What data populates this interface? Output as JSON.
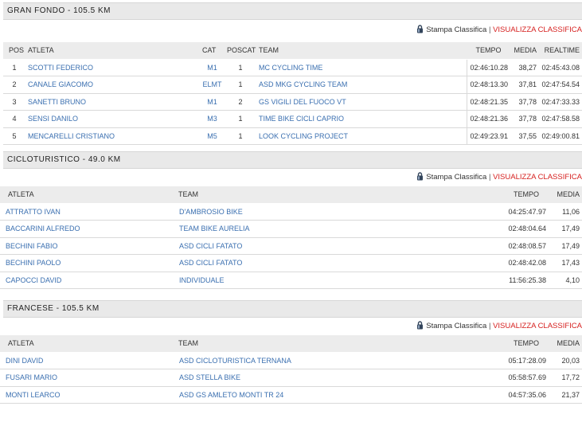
{
  "sections": [
    {
      "title": "GRAN FONDO - 105.5 KM",
      "print_label": "Stampa Classifica",
      "sep": "|",
      "view_label": "VISUALIZZA CLASSIFICA",
      "headers": {
        "pos": "POS",
        "athlete": "ATLETA",
        "cat": "CAT",
        "poscat": "POSCAT",
        "team": "TEAM",
        "time": "TEMPO",
        "avg": "MEDIA",
        "realtime": "REALTIME"
      },
      "rows": [
        {
          "pos": "1",
          "athlete": "SCOTTI FEDERICO",
          "cat": "M1",
          "poscat": "1",
          "team": "MC CYCLING TIME",
          "time": "02:46:10.28",
          "avg": "38,27",
          "realtime": "02:45:43.08"
        },
        {
          "pos": "2",
          "athlete": "CANALE GIACOMO",
          "cat": "ELMT",
          "poscat": "1",
          "team": "ASD MKG CYCLING TEAM",
          "time": "02:48:13.30",
          "avg": "37,81",
          "realtime": "02:47:54.54"
        },
        {
          "pos": "3",
          "athlete": "SANETTI BRUNO",
          "cat": "M1",
          "poscat": "2",
          "team": "GS VIGILI DEL FUOCO VT",
          "time": "02:48:21.35",
          "avg": "37,78",
          "realtime": "02:47:33.33"
        },
        {
          "pos": "4",
          "athlete": "SENSI DANILO",
          "cat": "M3",
          "poscat": "1",
          "team": "TIME BIKE CICLI CAPRIO",
          "time": "02:48:21.36",
          "avg": "37,78",
          "realtime": "02:47:58.58"
        },
        {
          "pos": "5",
          "athlete": "MENCARELLI CRISTIANO",
          "cat": "M5",
          "poscat": "1",
          "team": "LOOK CYCLING PROJECT",
          "time": "02:49:23.91",
          "avg": "37,55",
          "realtime": "02:49:00.81"
        }
      ]
    },
    {
      "title": "CICLOTURISTICO - 49.0 KM",
      "print_label": "Stampa Classifica",
      "sep": "|",
      "view_label": "VISUALIZZA CLASSIFICA",
      "headers": {
        "athlete": "ATLETA",
        "team": "TEAM",
        "time": "TEMPO",
        "avg": "MEDIA"
      },
      "rows": [
        {
          "athlete": "ATTRATTO IVAN",
          "team": "D'AMBROSIO BIKE",
          "time": "04:25:47.97",
          "avg": "11,06"
        },
        {
          "athlete": "BACCARINI ALFREDO",
          "team": "TEAM BIKE AURELIA",
          "time": "02:48:04.64",
          "avg": "17,49"
        },
        {
          "athlete": "BECHINI FABIO",
          "team": "ASD CICLI FATATO",
          "time": "02:48:08.57",
          "avg": "17,49"
        },
        {
          "athlete": "BECHINI PAOLO",
          "team": "ASD CICLI FATATO",
          "time": "02:48:42.08",
          "avg": "17,43"
        },
        {
          "athlete": "CAPOCCI DAVID",
          "team": "INDIVIDUALE",
          "time": "11:56:25.38",
          "avg": "4,10"
        }
      ]
    },
    {
      "title": "FRANCESE - 105.5 KM",
      "print_label": "Stampa Classifica",
      "sep": "|",
      "view_label": "VISUALIZZA CLASSIFICA",
      "headers": {
        "athlete": "ATLETA",
        "team": "TEAM",
        "time": "TEMPO",
        "avg": "MEDIA"
      },
      "rows": [
        {
          "athlete": "DINI DAVID",
          "team": "ASD CICLOTURISTICA TERNANA",
          "time": "05:17:28.09",
          "avg": "20,03"
        },
        {
          "athlete": "FUSARI MARIO",
          "team": "ASD STELLA BIKE",
          "time": "05:58:57.69",
          "avg": "17,72"
        },
        {
          "athlete": "MONTI LEARCO",
          "team": "ASD GS AMLETO MONTI TR 24",
          "time": "04:57:35.06",
          "avg": "21,37"
        }
      ]
    }
  ],
  "icons": {
    "print": "lock-icon"
  },
  "colors": {
    "link": "#3a6fb0",
    "accent": "#d6201f",
    "header_bg": "#e9e9e9"
  }
}
